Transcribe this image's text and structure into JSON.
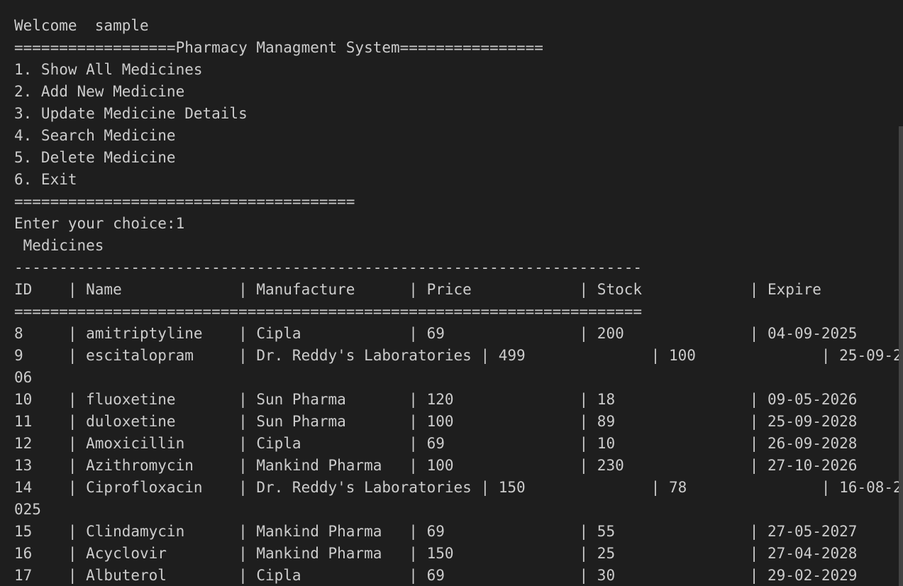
{
  "terminal": {
    "lines": [
      "Welcome  sample",
      "==================Pharmacy Managment System================",
      "1. Show All Medicines",
      "2. Add New Medicine",
      "3. Update Medicine Details",
      "4. Search Medicine",
      "5. Delete Medicine",
      "6. Exit",
      "======================================",
      "Enter your choice:1",
      " Medicines",
      "----------------------------------------------------------------------",
      "ID    | Name             | Manufacture      | Price            | Stock            | Expire",
      "======================================================================",
      "8     | amitriptyline    | Cipla            | 69               | 200              | 04-09-2025",
      "9     | escitalopram     | Dr. Reddy's Laboratories | 499              | 100              | 25-09-2",
      "06",
      "10    | fluoxetine       | Sun Pharma       | 120              | 18               | 09-05-2026",
      "11    | duloxetine       | Sun Pharma       | 100              | 89               | 25-09-2028",
      "12    | Amoxicillin      | Cipla            | 69               | 10               | 26-09-2028",
      "13    | Azithromycin     | Mankind Pharma   | 100              | 230              | 27-10-2026",
      "14    | Ciprofloxacin    | Dr. Reddy's Laboratories | 150              | 78               | 16-08-2",
      "025",
      "15    | Clindamycin      | Mankind Pharma   | 69               | 55               | 27-05-2027",
      "16    | Acyclovir        | Mankind Pharma   | 150              | 25               | 27-04-2028",
      "17    | Albuterol        | Cipla            | 69               | 30               | 29-02-2029"
    ]
  }
}
